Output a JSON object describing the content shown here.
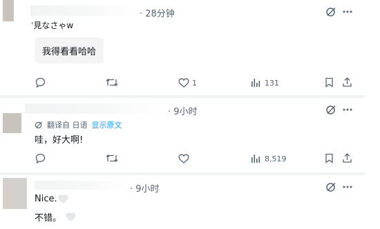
{
  "tweets": [
    {
      "time": "· 28分钟",
      "reply_to": "見なさゃw",
      "text": "我得看看哈哈",
      "actions": {
        "likes": "1",
        "views": "131"
      }
    },
    {
      "time": "· 9小时",
      "translate_label": "翻译自 日语",
      "show_original": "显示原文",
      "text": "哇，好大啊!",
      "actions": {
        "views": "8,519"
      }
    },
    {
      "time": "· 9小时",
      "lines": [
        "Nice.",
        "不错。"
      ]
    }
  ],
  "icons": {
    "grok": "grok-icon",
    "more": "more-icon",
    "reply": "reply-icon",
    "retweet": "retweet-icon",
    "like": "heart-icon",
    "views": "views-icon",
    "bookmark": "bookmark-icon",
    "share": "share-icon",
    "translate": "translate-icon"
  },
  "colors": {
    "text_primary": "#0f1419",
    "text_secondary": "#536471",
    "link_blue": "#1d9bf0",
    "divider": "#eff3f4",
    "card_bg": "#f4f4f5"
  }
}
